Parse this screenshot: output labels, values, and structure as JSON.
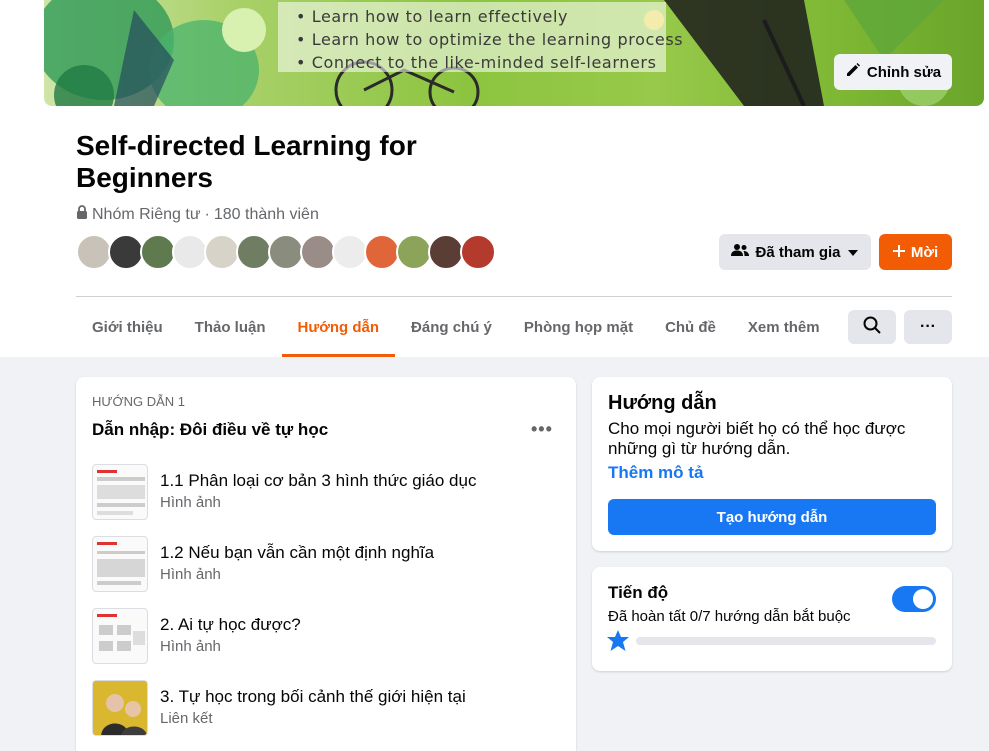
{
  "cover": {
    "lines": [
      "• Learn how to learn effectively",
      "• Learn how to optimize the learning process",
      "• Connect to the like-minded self-learners"
    ],
    "edit_label": "Chỉnh sửa"
  },
  "group": {
    "name": "Self-directed Learning for Beginners",
    "privacy": "Nhóm Riêng tư",
    "members": "180 thành viên",
    "joined_label": "Đã tham gia",
    "invite_label": "Mời"
  },
  "tabs": [
    "Giới thiệu",
    "Thảo luận",
    "Hướng dẫn",
    "Đáng chú ý",
    "Phòng họp mặt",
    "Chủ đề",
    "Xem thêm"
  ],
  "active_tab": 2,
  "guide": {
    "kicker": "HƯỚNG DẪN 1",
    "title": "Dẫn nhập: Đôi điều về tự học",
    "units": [
      {
        "title": "1.1 Phân loại cơ bản 3 hình thức giáo dục",
        "type": "Hình ảnh"
      },
      {
        "title": "1.2 Nếu bạn vẫn cần một định nghĩa",
        "type": "Hình ảnh"
      },
      {
        "title": "2. Ai tự học được?",
        "type": "Hình ảnh"
      },
      {
        "title": "3. Tự học trong bối cảnh thế giới hiện tại",
        "type": "Liên kết"
      }
    ]
  },
  "side": {
    "title": "Hướng dẫn",
    "desc": "Cho mọi người biết họ có thể học được những gì từ hướng dẫn.",
    "link": "Thêm mô tả",
    "button": "Tạo hướng dẫn"
  },
  "progress": {
    "title": "Tiến độ",
    "status": "Đã hoàn tất 0/7 hướng dẫn bắt buộc",
    "completed": 0,
    "total": 7,
    "toggle_on": true
  },
  "colors": {
    "accent": "#f25c05",
    "primary": "#1877f2",
    "bg": "#f0f2f5",
    "muted": "#65676b"
  }
}
